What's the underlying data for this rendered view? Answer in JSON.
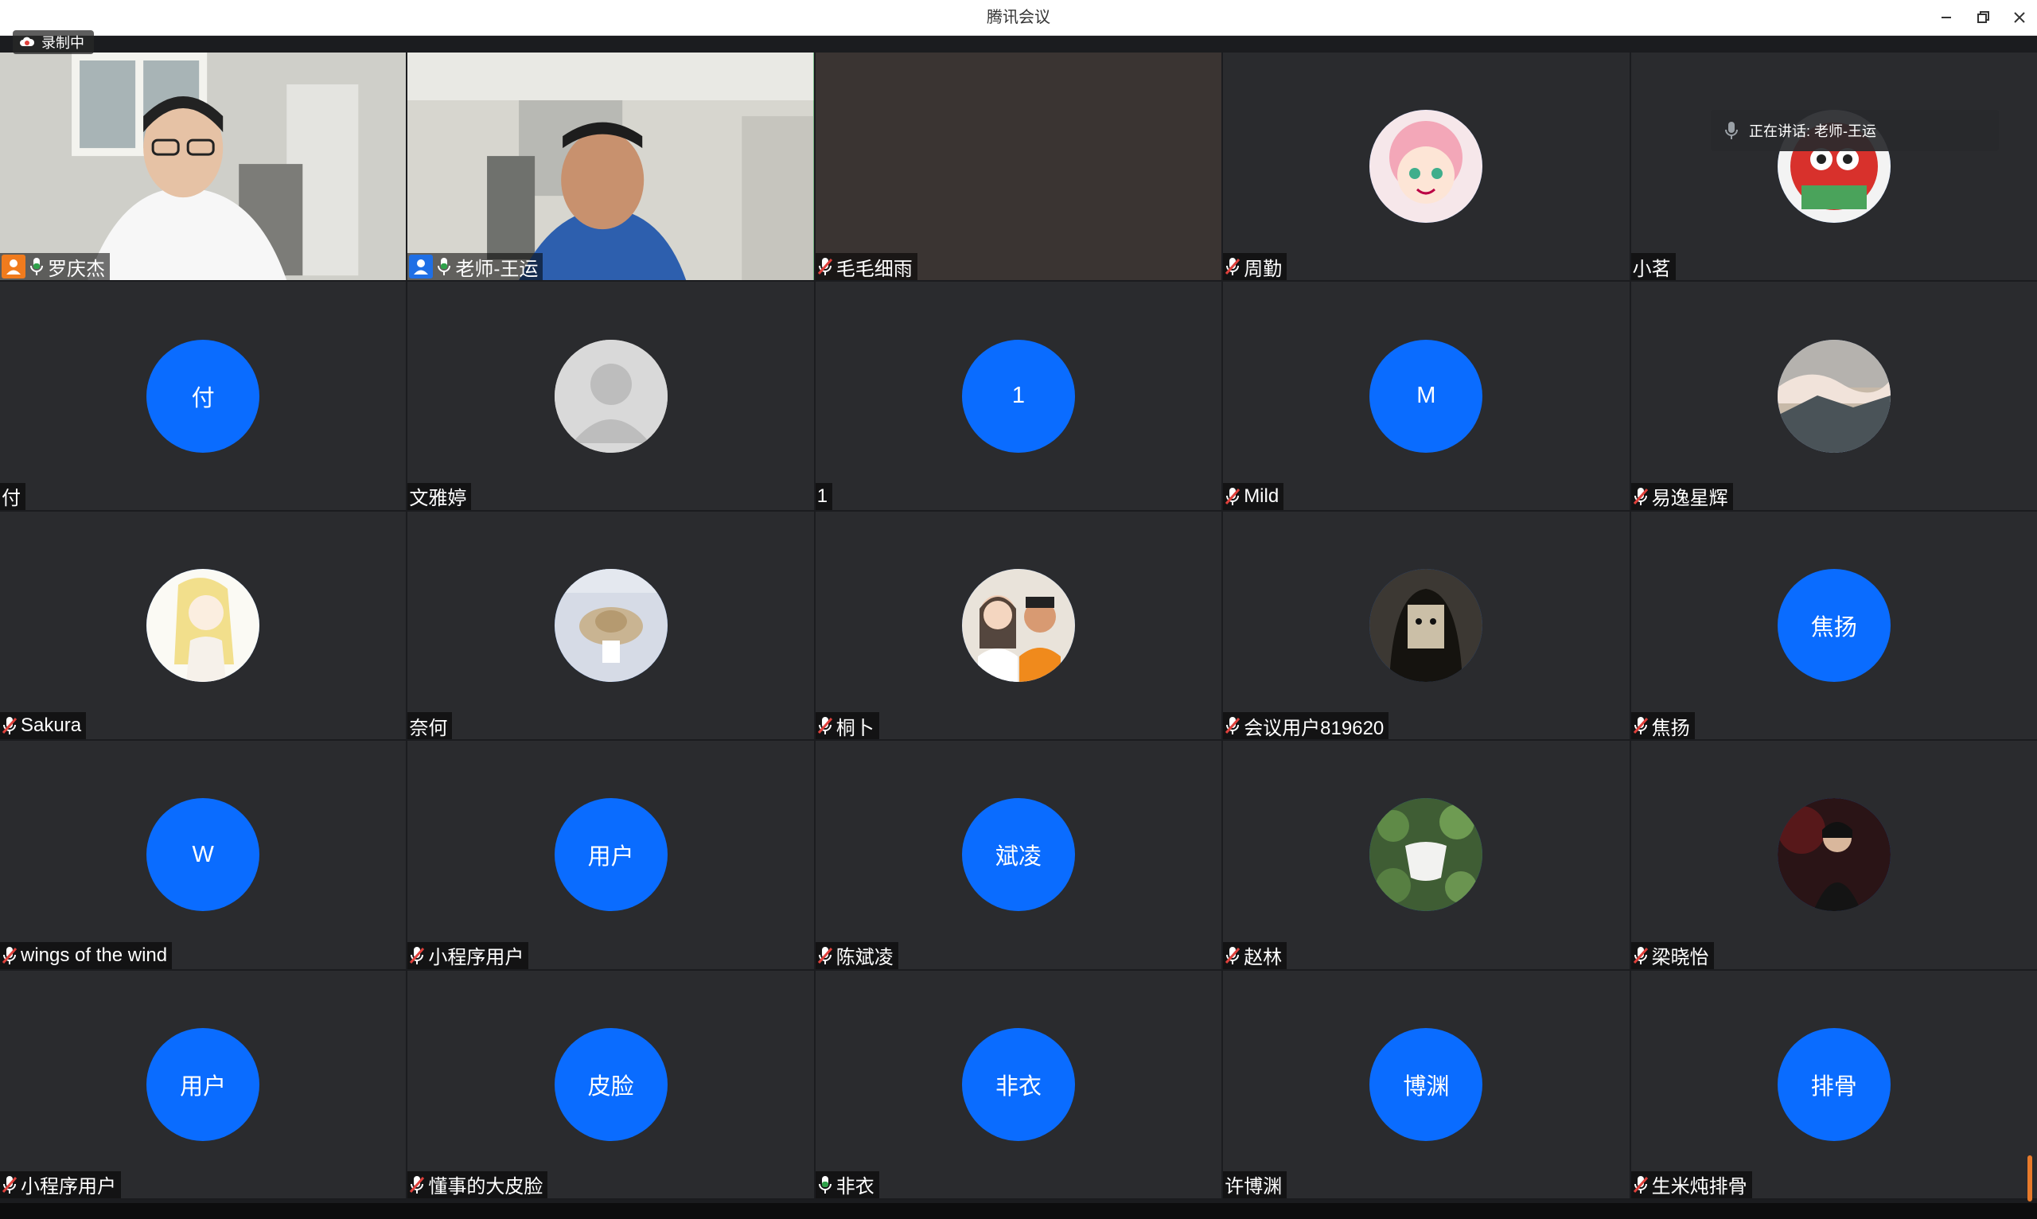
{
  "window": {
    "title": "腾讯会议"
  },
  "recording": {
    "label": "录制中"
  },
  "speaking": {
    "label": "正在讲话: 老师-王运"
  },
  "tiles": [
    {
      "name": "罗庆杰",
      "type": "video",
      "mic": "on",
      "host_badge": "host"
    },
    {
      "name": "老师-王运",
      "type": "video",
      "mic": "on",
      "host_badge": "cohost",
      "active": true
    },
    {
      "name": "毛毛细雨",
      "type": "blank",
      "mic": "muted"
    },
    {
      "name": "周勤",
      "type": "photo",
      "mic": "muted",
      "image": "anime-pink-hair-avatar"
    },
    {
      "name": "小茗",
      "type": "photo",
      "mic": "none",
      "image": "cartoon-red-avatar"
    },
    {
      "name": "付",
      "type": "initials",
      "initials": "付",
      "mic": "none"
    },
    {
      "name": "文雅婷",
      "type": "default",
      "mic": "none"
    },
    {
      "name": "1",
      "type": "initials",
      "initials": "1",
      "mic": "none"
    },
    {
      "name": "Mild",
      "type": "initials",
      "initials": "M",
      "mic": "muted"
    },
    {
      "name": "易逸星辉",
      "type": "photo",
      "mic": "muted",
      "image": "sunset-mountain-avatar"
    },
    {
      "name": "Sakura",
      "type": "photo",
      "mic": "muted",
      "image": "anime-blonde-girl-avatar"
    },
    {
      "name": "奈何",
      "type": "photo",
      "mic": "none",
      "image": "straw-hat-avatar"
    },
    {
      "name": "桐卜",
      "type": "photo",
      "mic": "muted",
      "image": "couple-selfie-avatar"
    },
    {
      "name": "会议用户819620",
      "type": "photo",
      "mic": "muted",
      "image": "masked-figure-avatar"
    },
    {
      "name": "焦扬",
      "type": "initials",
      "initials": "焦扬",
      "mic": "muted"
    },
    {
      "name": "wings of the wind",
      "type": "initials",
      "initials": "W",
      "mic": "muted"
    },
    {
      "name": "小程序用户",
      "type": "initials",
      "initials": "用户",
      "mic": "muted"
    },
    {
      "name": "陈斌凌",
      "type": "initials",
      "initials": "斌凌",
      "mic": "muted"
    },
    {
      "name": "赵林",
      "type": "photo",
      "mic": "muted",
      "image": "leaf-cup-avatar"
    },
    {
      "name": "梁晓怡",
      "type": "photo",
      "mic": "muted",
      "image": "dark-portrait-avatar"
    },
    {
      "name": "小程序用户",
      "type": "initials",
      "initials": "用户",
      "mic": "muted"
    },
    {
      "name": "懂事的大皮脸",
      "type": "initials",
      "initials": "皮脸",
      "mic": "muted"
    },
    {
      "name": "非衣",
      "type": "initials",
      "initials": "非衣",
      "mic": "on"
    },
    {
      "name": "许博渊",
      "type": "initials",
      "initials": "博渊",
      "mic": "none"
    },
    {
      "name": "生米炖排骨",
      "type": "initials",
      "initials": "排骨",
      "mic": "muted"
    }
  ],
  "colors": {
    "avatar_blue": "#0a6cff",
    "tile_bg": "#2a2b2e",
    "active_border": "#2fa14a",
    "muted_red": "#e0413c"
  }
}
